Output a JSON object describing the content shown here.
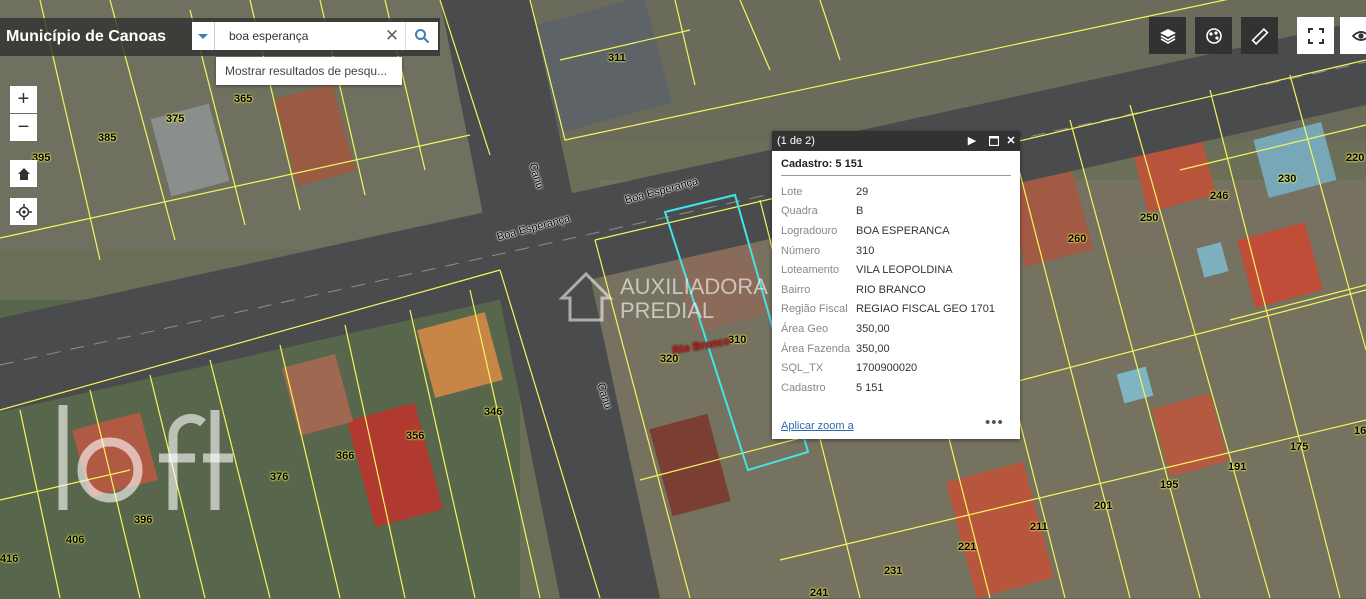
{
  "header": {
    "title": "Município de Canoas",
    "search_value": "boa esperança",
    "suggestion": "Mostrar resultados de pesqu..."
  },
  "map_controls": {
    "zoom_in": "+",
    "zoom_out": "−"
  },
  "toolbar": {
    "icons": [
      "layers-icon",
      "basemap-gallery-icon",
      "measure-icon",
      "fullscreen-icon",
      "eye-icon"
    ]
  },
  "streets": {
    "horizontal_a": "Boa Esperança",
    "horizontal_b": "Boa Esperança",
    "vertical_a": "Canu",
    "vertical_b": "Canu"
  },
  "parcel_labels": {
    "p311": "311",
    "p365": "365",
    "p375": "375",
    "p385": "385",
    "p395": "395",
    "p220": "220",
    "p230": "230",
    "p246": "246",
    "p250": "250",
    "p260": "260",
    "p310": "310",
    "p320": "320",
    "p346": "346",
    "p356": "356",
    "p366": "366",
    "p376": "376",
    "p396": "396",
    "p406": "406",
    "p416": "416",
    "p231": "231",
    "p241": "241",
    "p221": "221",
    "p211": "211",
    "p201": "201",
    "p195": "195",
    "p191": "191",
    "p175": "175",
    "p165": "16"
  },
  "neighborhood_label": "Rio Branco",
  "popup": {
    "counter": "(1 de 2)",
    "title": "Cadastro: 5 151",
    "attributes": [
      {
        "key": "Lote",
        "value": "29"
      },
      {
        "key": "Quadra",
        "value": "B"
      },
      {
        "key": "Logradouro",
        "value": "BOA ESPERANCA"
      },
      {
        "key": "Número",
        "value": "310"
      },
      {
        "key": "Loteamento",
        "value": "VILA LEOPOLDINA"
      },
      {
        "key": "Bairro",
        "value": "RIO BRANCO"
      },
      {
        "key": "Região Fiscal",
        "value": "REGIAO FISCAL GEO 1701"
      },
      {
        "key": "Área Geo",
        "value": "350,00"
      },
      {
        "key": "Área Fazenda",
        "value": "350,00"
      },
      {
        "key": "SQL_TX",
        "value": "1700900020"
      },
      {
        "key": "Cadastro",
        "value": "5 151"
      }
    ],
    "zoom_link": "Aplicar zoom a",
    "more": "•••"
  },
  "watermark": {
    "line1": "AUXILIADORA",
    "line2": "PREDIAL"
  },
  "colors": {
    "parcel_line": "#f5f55a",
    "selected_parcel": "#3fe6e6",
    "panel_dark": "#323232",
    "link": "#2c6ba8"
  }
}
